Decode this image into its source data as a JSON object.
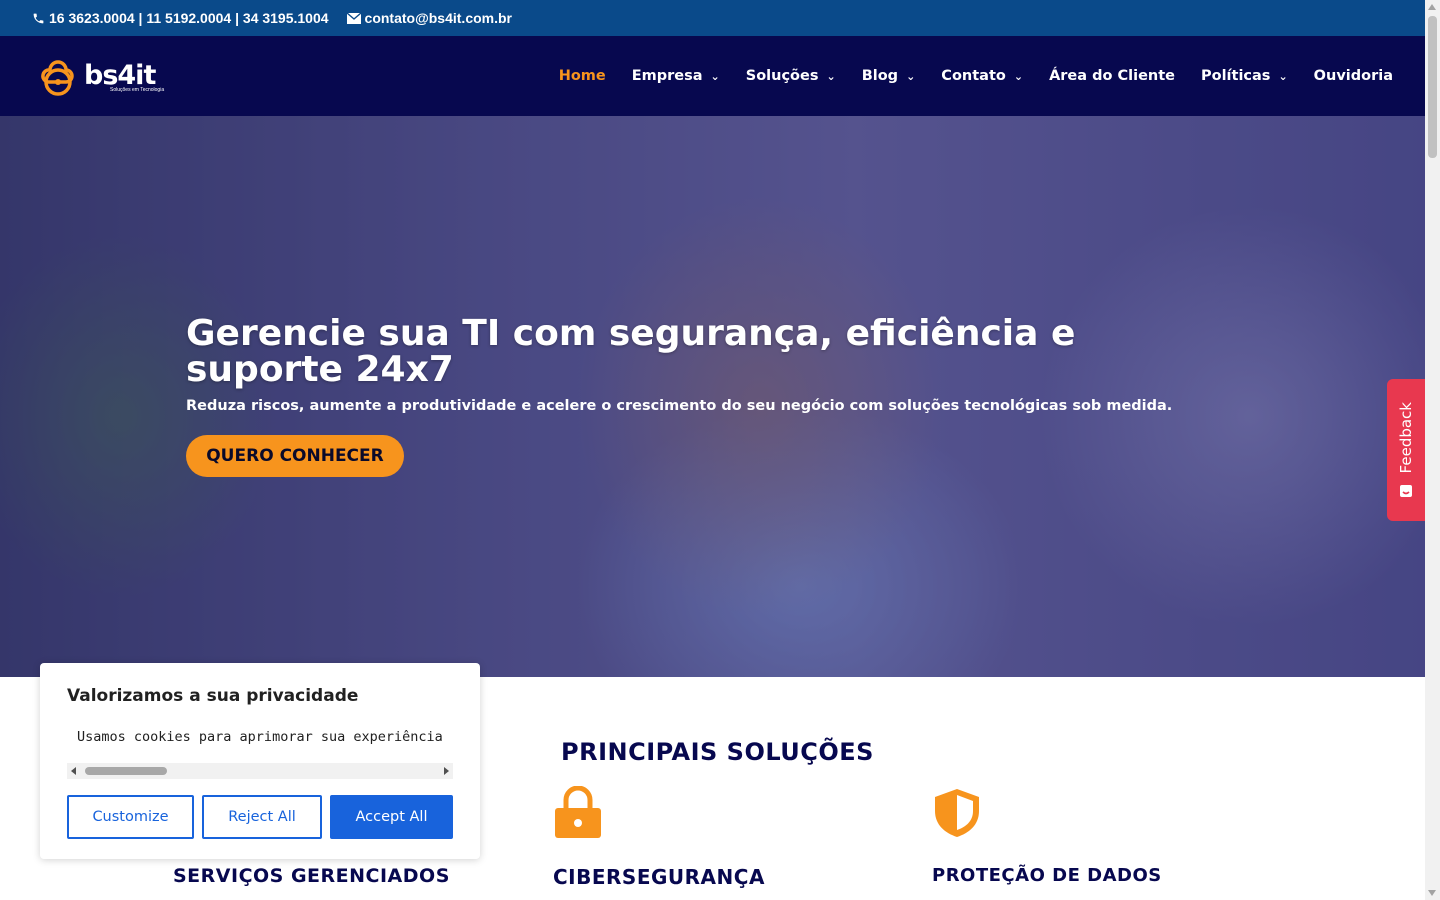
{
  "topbar": {
    "phones": "16 3623.0004 | 11 5192.0004 | 34 3195.1004",
    "email": "contato@bs4it.com.br"
  },
  "brand": {
    "name": "bs4it",
    "tagline": "Soluções em Tecnologia",
    "accent": "#f7941d",
    "navy": "#07084f",
    "topbar_blue": "#0a4a8a"
  },
  "nav": {
    "items": [
      {
        "label": "Home",
        "active": true,
        "dropdown": false
      },
      {
        "label": "Empresa",
        "dropdown": true
      },
      {
        "label": "Soluções",
        "dropdown": true
      },
      {
        "label": "Blog",
        "dropdown": true
      },
      {
        "label": "Contato",
        "dropdown": true
      },
      {
        "label": "Área do Cliente",
        "dropdown": false
      },
      {
        "label": "Políticas",
        "dropdown": true
      },
      {
        "label": "Ouvidoria",
        "dropdown": false
      }
    ]
  },
  "hero": {
    "title": "Gerencie sua TI com segurança, eficiência e suporte 24x7",
    "subtitle": "Reduza riscos, aumente a produtividade e acelere o crescimento do seu negócio com soluções tecnológicas sob medida.",
    "cta": "QUERO CONHECER"
  },
  "feedback": {
    "label": "Feedback",
    "color": "#e8384f"
  },
  "solutions": {
    "title": "PRINCIPAIS SOLUÇÕES",
    "items": [
      {
        "label": "SERVIÇOS GERENCIADOS"
      },
      {
        "label": "CIBERSEGURANÇA",
        "icon": "lock-icon"
      },
      {
        "label": "PROTEÇÃO DE DADOS",
        "icon": "shield-icon"
      }
    ]
  },
  "cookie": {
    "title": "Valorizamos a sua privacidade",
    "text": "Usamos cookies para aprimorar sua experiência",
    "customize": "Customize",
    "reject": "Reject All",
    "accept": "Accept All",
    "button_color": "#1863dc"
  }
}
